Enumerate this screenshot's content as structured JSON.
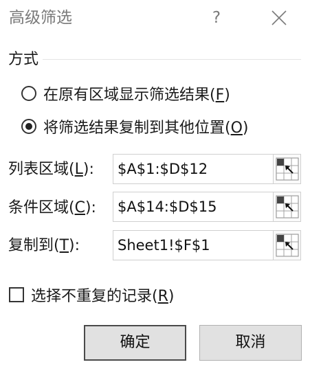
{
  "window": {
    "title": "高级筛选",
    "help_label": "?"
  },
  "method_group": {
    "label": "方式",
    "options": [
      {
        "text": "在原有区域显示筛选结果(",
        "key": "F",
        "suffix": ")",
        "selected": false
      },
      {
        "text": "将筛选结果复制到其他位置(",
        "key": "O",
        "suffix": ")",
        "selected": true
      }
    ]
  },
  "fields": {
    "list_range": {
      "label_pre": "列表区域(",
      "key": "L",
      "label_post": "):",
      "value": "$A$1:$D$12"
    },
    "criteria_range": {
      "label_pre": "条件区域(",
      "key": "C",
      "label_post": "):",
      "value": "$A$14:$D$15"
    },
    "copy_to": {
      "label_pre": "复制到(",
      "key": "T",
      "label_post": "):",
      "value": "Sheet1!$F$1"
    }
  },
  "unique_records": {
    "label_pre": "选择不重复的记录(",
    "key": "R",
    "label_post": ")",
    "checked": false
  },
  "buttons": {
    "ok": "确定",
    "cancel": "取消"
  },
  "icons": {
    "help": "question-mark",
    "close": "close-x",
    "range_picker": "collapse-dialog-range-picker"
  }
}
